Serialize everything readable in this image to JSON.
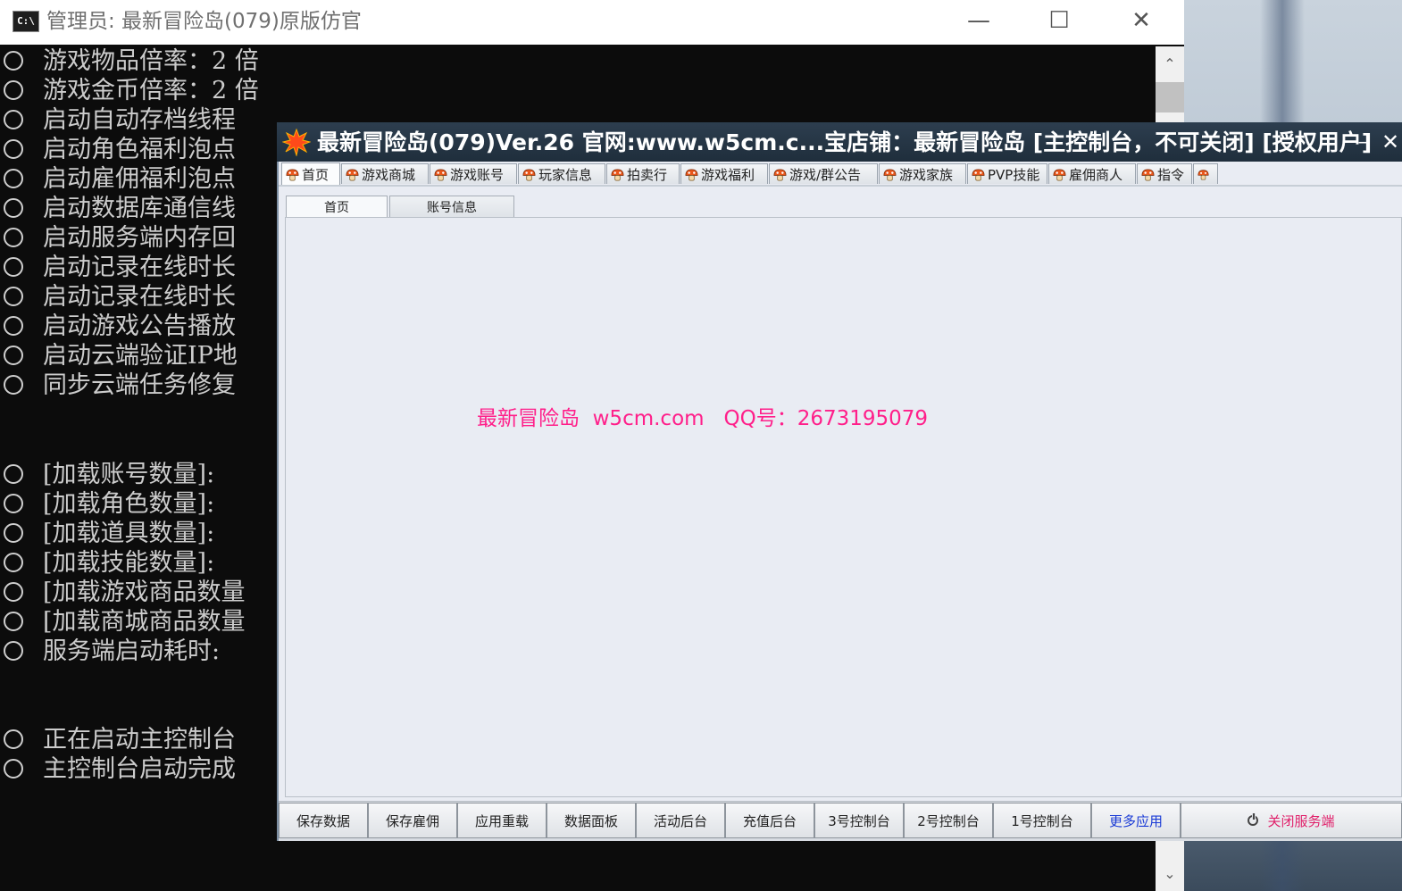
{
  "console": {
    "title": "管理员:  最新冒险岛(079)原版仿官",
    "icon_label": "C:\\",
    "controls": {
      "minimize": "—",
      "maximize": "☐",
      "close": "✕"
    },
    "lines_top": [
      "游戏物品倍率：2 倍",
      "游戏金币倍率：2 倍",
      "启动自动存档线程",
      "启动角色福利泡点",
      "启动雇佣福利泡点",
      "启动数据库通信线",
      "启动服务端内存回",
      "启动记录在线时长",
      "启动记录在线时长",
      "启动游戏公告播放",
      "启动云端验证IP地",
      "同步云端任务修复"
    ],
    "lines_mid": [
      "[加载账号数量]:",
      "[加载角色数量]:",
      "[加载道具数量]:",
      "[加载技能数量]:",
      "[加载游戏商品数量",
      "[加载商城商品数量",
      "服务端启动耗时:"
    ],
    "lines_bottom": [
      "正在启动主控制台",
      "主控制台启动完成"
    ],
    "scroll_up": "⌃",
    "scroll_down": "⌄"
  },
  "app": {
    "title": "最新冒险岛(079)Ver.26 官网:www.w5cm.c...宝店铺：最新冒险岛 [主控制台，不可关闭] [授权用户]",
    "minimize": "–",
    "close": "✕",
    "main_tabs": [
      "首页",
      "游戏商城",
      "游戏账号",
      "玩家信息",
      "拍卖行",
      "游戏福利",
      "游戏/群公告",
      "游戏家族",
      "PVP技能",
      "雇佣商人",
      "指令",
      ""
    ],
    "sub_tabs": [
      "首页",
      "账号信息"
    ],
    "promo_text": "最新冒险岛  w5cm.com   QQ号：2673195079",
    "bottom_buttons": [
      "保存数据",
      "保存雇佣",
      "应用重载",
      "数据面板",
      "活动后台",
      "充值后台",
      "3号控制台",
      "2号控制台",
      "1号控制台",
      "更多应用",
      "关闭服务端"
    ],
    "colors": {
      "promo": "#ff1f8a",
      "more_apps": "#1a3bd6",
      "shutdown": "#e0206a",
      "titlebar": "#1f2e3c"
    },
    "tab_icon": "mushroom-icon"
  }
}
